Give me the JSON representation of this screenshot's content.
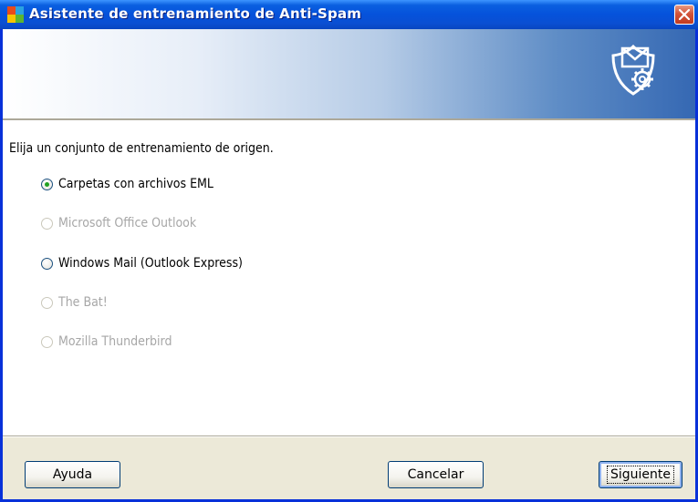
{
  "window": {
    "title": "Asistente de entrenamiento de Anti-Spam",
    "icon": "avg-logo-icon",
    "close": "close-icon"
  },
  "banner": {
    "icon": "shield-mail-gear-icon"
  },
  "content": {
    "prompt": "Elija un conjunto de entrenamiento de origen.",
    "options": [
      {
        "label": "Carpetas con archivos EML",
        "checked": true,
        "enabled": true
      },
      {
        "label": "Microsoft Office Outlook",
        "checked": false,
        "enabled": false
      },
      {
        "label": "Windows Mail (Outlook Express)",
        "checked": false,
        "enabled": true
      },
      {
        "label": "The Bat!",
        "checked": false,
        "enabled": false
      },
      {
        "label": "Mozilla Thunderbird",
        "checked": false,
        "enabled": false
      }
    ]
  },
  "buttons": {
    "help": "Ayuda",
    "cancel": "Cancelar",
    "next": "Siguiente"
  },
  "colors": {
    "titlebar": "#0552db",
    "border": "#0831d9",
    "check": "#21a121"
  }
}
